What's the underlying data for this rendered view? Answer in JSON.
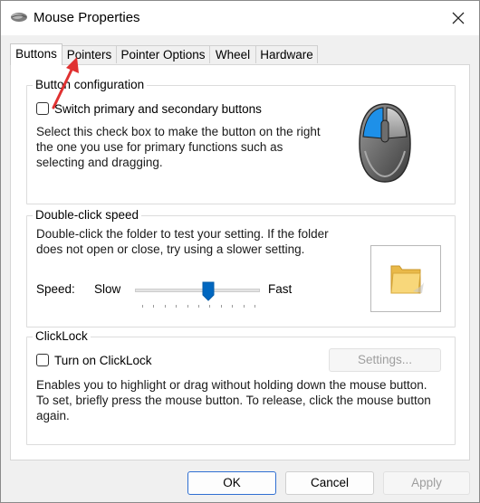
{
  "window": {
    "title": "Mouse Properties"
  },
  "tabs": [
    {
      "label": "Buttons",
      "active": true
    },
    {
      "label": "Pointers",
      "active": false
    },
    {
      "label": "Pointer Options",
      "active": false
    },
    {
      "label": "Wheel",
      "active": false
    },
    {
      "label": "Hardware",
      "active": false
    }
  ],
  "button_configuration": {
    "group_label": "Button configuration",
    "checkbox_label": "Switch primary and secondary buttons",
    "checked": false,
    "description": [
      "Select this check box to make the button on the right",
      "the one you use for primary functions such as",
      "selecting and dragging."
    ]
  },
  "double_click_speed": {
    "group_label": "Double-click speed",
    "description": [
      "Double-click the folder to test your setting. If the folder",
      "does not open or close, try using a slower setting."
    ],
    "speed_label": "Speed:",
    "slow_label": "Slow",
    "fast_label": "Fast",
    "slider_value_fraction": 0.6,
    "tick_count": 11
  },
  "clicklock": {
    "group_label": "ClickLock",
    "checkbox_label": "Turn on ClickLock",
    "checked": false,
    "settings_button": "Settings...",
    "settings_enabled": false,
    "description": [
      "Enables you to highlight or drag without holding down the mouse button.",
      "To set, briefly press the mouse button. To release, click the mouse button",
      "again."
    ]
  },
  "footer": {
    "ok": "OK",
    "cancel": "Cancel",
    "apply": "Apply",
    "apply_enabled": false
  },
  "colors": {
    "accent": "#0067c0",
    "annotation_arrow": "#e03131",
    "folder": "#f2cf6b"
  },
  "icons": {
    "title_icon": "mouse-icon",
    "close": "close-icon",
    "preview_mouse": "mouse-illustration",
    "preview_folder": "folder-icon",
    "annotation": "red-arrow-annotation"
  }
}
